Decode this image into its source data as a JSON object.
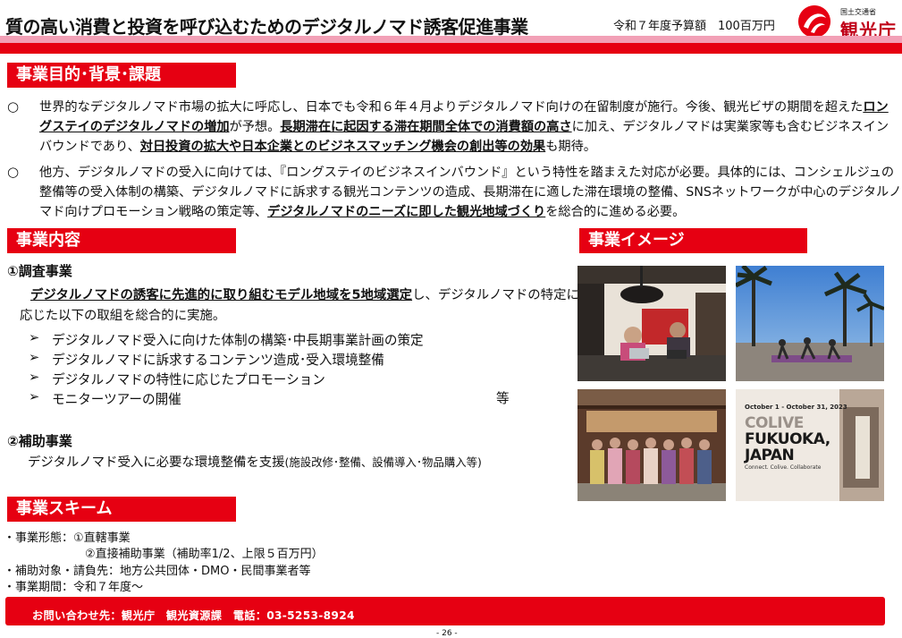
{
  "header": {
    "title": "質の高い消費と投資を呼び込むためのデジタルノマド誘客促進事業",
    "budget_label": "令和７年度予算額　100百万円",
    "logo_small": "国土交通省",
    "logo_text": "観光庁"
  },
  "sections": {
    "purpose": "事業目的･背景･課題",
    "content": "事業内容",
    "image": "事業イメージ",
    "scheme": "事業スキーム"
  },
  "purpose": {
    "bullet": "○",
    "p1": {
      "s1": "世界的なデジタルノマド市場の拡大に呼応し、日本でも令和６年４月よりデジタルノマド向けの在留制度が施行。今後、観光ビザの期間を超えた",
      "u1": "ロングステイのデジタルノマドの増加",
      "s2": "が予想。",
      "u2": "長期滞在に起因する滞在期間全体での消費額の高さ",
      "s3": "に加え、デジタルノマドは実業家等も含むビジネスインバウンドであり、",
      "u3": "対日投資の拡大や日本企業とのビジネスマッチング機会の創出等の効果",
      "s4": "も期待。"
    },
    "p2": {
      "s1": "他方、デジタルノマドの受入に向けては、『ロングステイのビジネスインバウンド』という特性を踏まえた対応が必要。具体的には、コンシェルジュの整備等の受入体制の構築、デジタルノマドに訴求する観光コンテンツの造成、長期滞在に適した滞在環境の整備、SNSネットワークが中心のデジタルノマド向けプロモーション戦略の策定等、",
      "u1": "デジタルノマドのニーズに即した観光地域づくり",
      "s2": "を総合的に進める必要。"
    }
  },
  "content": {
    "survey_heading": "①調査事業",
    "survey_u": "デジタルノマドの誘客に先進的に取り組むモデル地域を5地域選定",
    "survey_rest": "し、デジタルノマドの特定に応じた以下の取組を総合的に実施。",
    "arrow": "➢",
    "items": [
      "デジタルノマド受入に向けた体制の構築･中長期事業計画の策定",
      "デジタルノマドに訴求するコンテンツ造成･受入環境整備",
      "デジタルノマドの特性に応じたプロモーション",
      "モニターツアーの開催"
    ],
    "etc": "等",
    "subsidy_heading": "②補助事業",
    "subsidy_main": "デジタルノマド受入に必要な環境整備を支援",
    "subsidy_note": "(施設改修･整備、設備導入･物品購入等)"
  },
  "images": {
    "colive_date": "October 1 - October 31, 2023",
    "colive_word": "COLIVE",
    "colive_city": "FUKUOKA,",
    "colive_country": "JAPAN",
    "colive_tag": "Connect. Colive. Collaborate"
  },
  "scheme": [
    "・事業形態：①直轄事業",
    "②直接補助事業（補助率1/2、上限５百万円）",
    "・補助対象・請負先：地方公共団体・DMO・民間事業者等",
    "・事業期間：令和７年度～"
  ],
  "footer": {
    "contact": "お問い合わせ先：観光庁　観光資源課　電話：03-5253-8924",
    "page": "- 26 -"
  }
}
